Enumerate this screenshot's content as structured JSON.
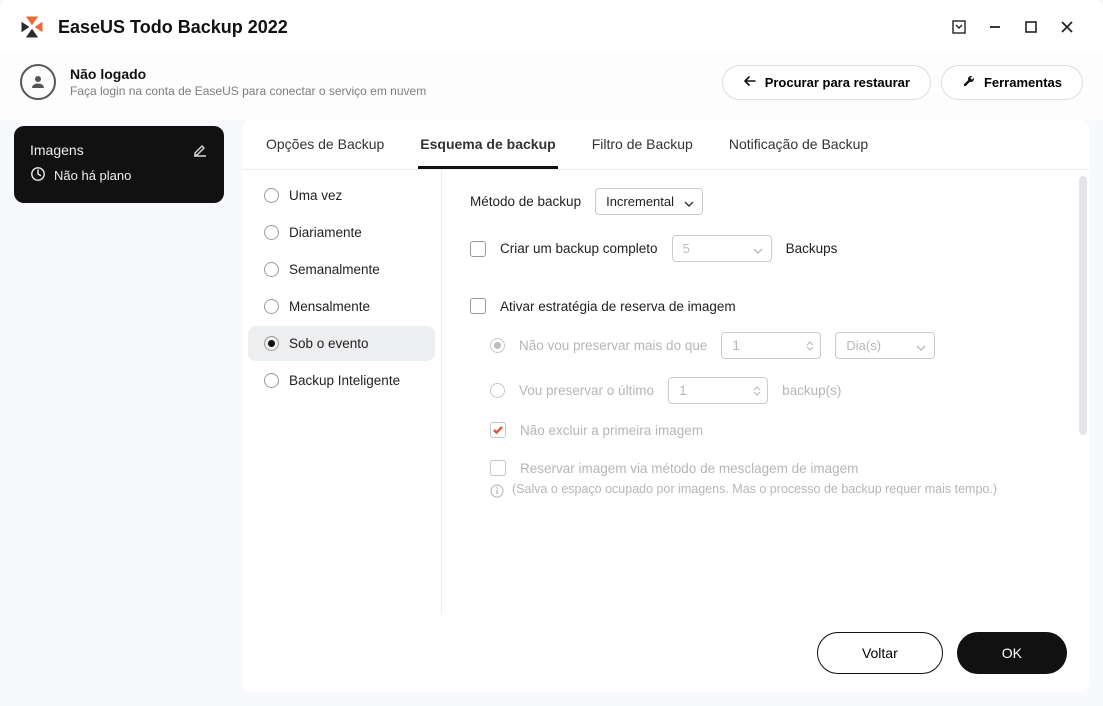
{
  "app": {
    "title": "EaseUS Todo Backup 2022"
  },
  "account": {
    "status": "Não logado",
    "hint": "Faça login na conta de EaseUS para conectar o serviço em nuvem"
  },
  "header_buttons": {
    "restore": "Procurar para restaurar",
    "tools": "Ferramentas"
  },
  "sidebar": {
    "title": "Imagens",
    "plan": "Não há plano"
  },
  "tabs": {
    "options": "Opções de Backup",
    "scheme": "Esquema de backup",
    "filter": "Filtro de Backup",
    "notify": "Notificação de Backup"
  },
  "schedule_items": {
    "once": "Uma vez",
    "daily": "Diariamente",
    "weekly": "Semanalmente",
    "monthly": "Mensalmente",
    "event": "Sob o evento",
    "smart": "Backup Inteligente"
  },
  "settings": {
    "method_label": "Método de backup",
    "method_value": "Incremental",
    "full_backup_label": "Criar um backup completo",
    "full_backup_value": "5",
    "backups_suffix": "Backups",
    "enable_strategy": "Ativar estratégia de reserva de imagem",
    "preserve_not_more": "Não vou preservar mais do que",
    "preserve_n_value": "1",
    "preserve_unit": "Dia(s)",
    "preserve_last": "Vou preservar o último",
    "preserve_last_value": "1",
    "preserve_last_suffix": "backup(s)",
    "no_delete_first": "Não excluir a primeira imagem",
    "reserve_merge": "Reservar imagem via método de mesclagem de imagem",
    "info_note": "(Salva o espaço ocupado por imagens. Mas o processo de backup requer mais tempo.)"
  },
  "footer": {
    "back": "Voltar",
    "ok": "OK"
  }
}
